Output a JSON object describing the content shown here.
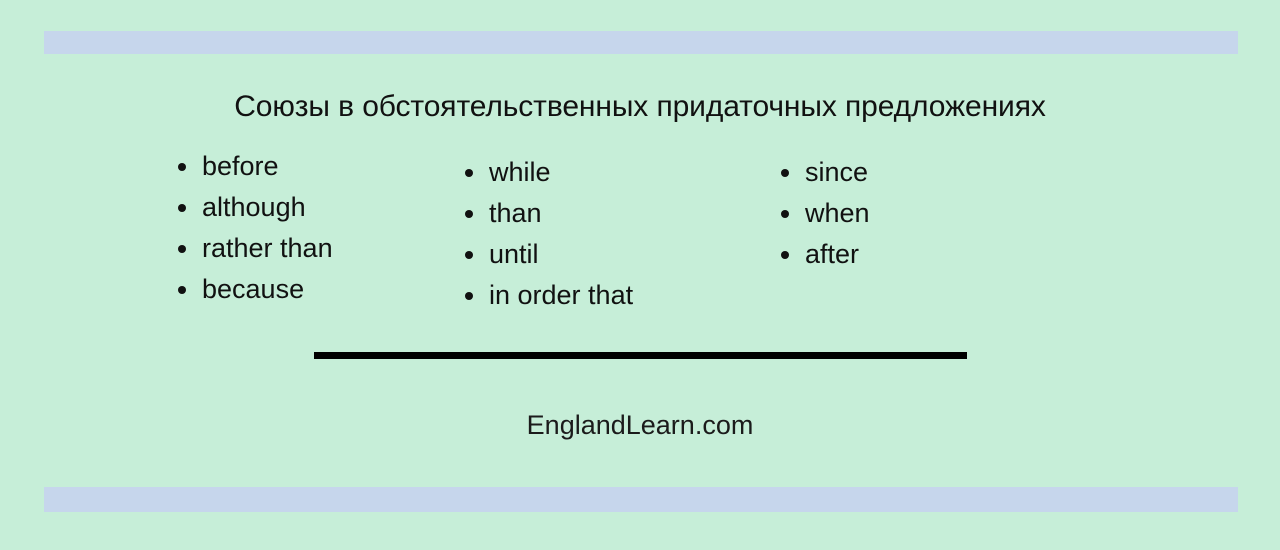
{
  "page": {
    "background_color": "#c6eed8",
    "accent_bar_color": "#c6d6ec",
    "divider_color": "#000000",
    "text_color": "#111111"
  },
  "title": "Союзы в обстоятельственных придаточных предложениях",
  "columns": [
    {
      "items": [
        {
          "label": "before"
        },
        {
          "label": "although"
        },
        {
          "label": "rather than"
        },
        {
          "label": "because"
        }
      ]
    },
    {
      "items": [
        {
          "label": "while"
        },
        {
          "label": "than"
        },
        {
          "label": "until"
        },
        {
          "label": "in order that"
        }
      ]
    },
    {
      "items": [
        {
          "label": "since"
        },
        {
          "label": "when"
        },
        {
          "label": "after"
        }
      ]
    }
  ],
  "footer": "EnglandLearn.com"
}
